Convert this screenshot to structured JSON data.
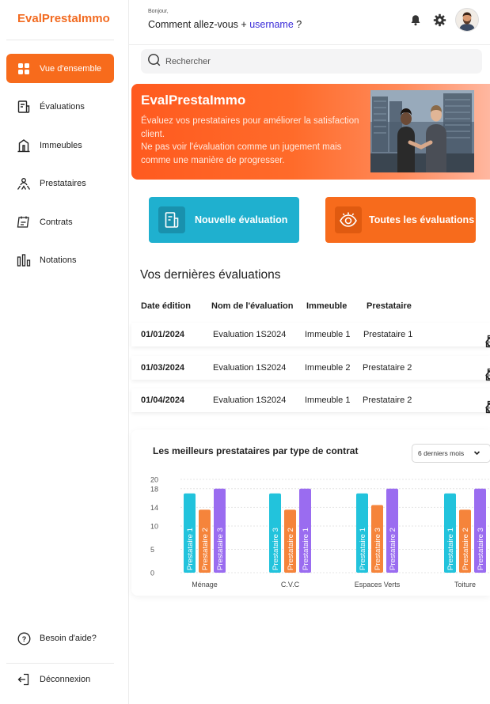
{
  "sidebar": {
    "brand": "EvalPrestaImmo",
    "items": [
      {
        "label": "Vue d'ensemble",
        "icon": "grid-icon",
        "active": true
      },
      {
        "label": "Évaluations",
        "icon": "document-icon",
        "active": false
      },
      {
        "label": "Immeubles",
        "icon": "building-icon",
        "active": false
      },
      {
        "label": "Prestataires",
        "icon": "people-icon",
        "active": false
      },
      {
        "label": "Contrats",
        "icon": "contract-icon",
        "active": false
      },
      {
        "label": "Notations",
        "icon": "bar-chart-icon",
        "active": false
      }
    ],
    "help": "Besoin d'aide?",
    "logout": "Déconnexion"
  },
  "header": {
    "greeting_small": "Bonjour,",
    "greeting_prefix": "Comment allez-vous +",
    "username": "username",
    "greeting_suffix": "?"
  },
  "search": {
    "placeholder": "Rechercher"
  },
  "banner": {
    "title": "EvalPrestaImmo",
    "line1": "Évaluez vos prestataires pour améliorer la satisfaction client.",
    "line2": "Ne pas voir l'évaluation comme un jugement mais comme une manière de progresser."
  },
  "actions": {
    "new_label": "Nouvelle évaluation",
    "all_label": "Toutes les évaluations"
  },
  "evaluations": {
    "title": "Vos dernières évaluations",
    "columns": [
      "Date édition",
      "Nom de l'évaluation",
      "Immeuble",
      "Prestataire"
    ],
    "rows": [
      {
        "date": "01/01/2024",
        "name": "Evaluation 1S2024",
        "building": "Immeuble 1",
        "provider": "Prestataire 1"
      },
      {
        "date": "01/03/2024",
        "name": "Evaluation 1S2024",
        "building": "Immeuble 2",
        "provider": "Prestataire 2"
      },
      {
        "date": "01/04/2024",
        "name": "Evaluation 1S2024",
        "building": "Immeuble 1",
        "provider": "Prestataire 2"
      }
    ]
  },
  "chart_card": {
    "title": "Les meilleurs prestataires par type de contrat",
    "period": "6 derniers mois"
  },
  "chart_data": {
    "type": "bar",
    "categories": [
      "Ménage",
      "C.V.C",
      "Espaces Verts",
      "Toiture"
    ],
    "ylim": [
      0,
      20
    ],
    "yticks": [
      0,
      5,
      10,
      14,
      18,
      20
    ],
    "bars": [
      [
        {
          "label": "Prestataire 1",
          "value": 17,
          "color": "#22c3dc"
        },
        {
          "label": "Prestataire 2",
          "value": 13.5,
          "color": "#f5843b"
        },
        {
          "label": "Prestataire 3",
          "value": 18,
          "color": "#9a6cf0"
        }
      ],
      [
        {
          "label": "Prestataire 3",
          "value": 17,
          "color": "#22c3dc"
        },
        {
          "label": "Prestataire 2",
          "value": 13.5,
          "color": "#f5843b"
        },
        {
          "label": "Prestataire 1",
          "value": 18,
          "color": "#9a6cf0"
        }
      ],
      [
        {
          "label": "Prestataire 1",
          "value": 17,
          "color": "#22c3dc"
        },
        {
          "label": "Prestataire 3",
          "value": 14.5,
          "color": "#f5843b"
        },
        {
          "label": "Prestataire 2",
          "value": 18,
          "color": "#9a6cf0"
        }
      ],
      [
        {
          "label": "Prestataire 1",
          "value": 17,
          "color": "#22c3dc"
        },
        {
          "label": "Prestataire 2",
          "value": 13.5,
          "color": "#f5843b"
        },
        {
          "label": "Prestataire 3",
          "value": 18,
          "color": "#9a6cf0"
        }
      ]
    ]
  },
  "colors": {
    "accent": "#f76b1c",
    "teal": "#1fb0cf",
    "username": "#3a2bd8"
  }
}
